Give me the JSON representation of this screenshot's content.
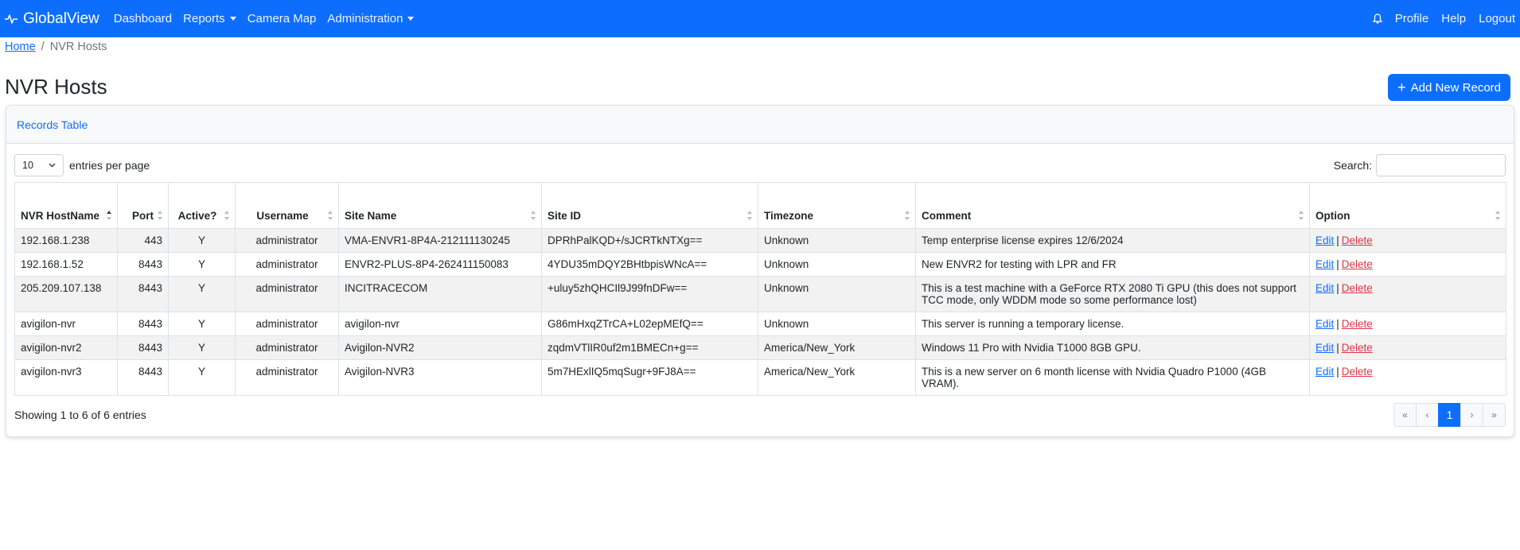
{
  "app": {
    "brand": "GlobalView"
  },
  "nav": {
    "items": [
      {
        "label": "Dashboard",
        "dropdown": false
      },
      {
        "label": "Reports",
        "dropdown": true
      },
      {
        "label": "Camera Map",
        "dropdown": false
      },
      {
        "label": "Administration",
        "dropdown": true
      }
    ],
    "right": {
      "profile": "Profile",
      "help": "Help",
      "logout": "Logout"
    }
  },
  "breadcrumb": {
    "home": "Home",
    "current": "NVR Hosts"
  },
  "page": {
    "title": "NVR Hosts",
    "add_button": "Add New Record"
  },
  "card": {
    "header": "Records Table"
  },
  "controls": {
    "entries_value": "10",
    "entries_label": "entries per page",
    "search_label": "Search:",
    "search_value": ""
  },
  "table": {
    "columns": [
      "NVR HostName",
      "Port",
      "Active?",
      "Username",
      "Site Name",
      "Site ID",
      "Timezone",
      "Comment",
      "Option"
    ],
    "rows": [
      {
        "host": "192.168.1.238",
        "port": "443",
        "active": "Y",
        "username": "administrator",
        "site_name": "VMA-ENVR1-8P4A-212111130245",
        "site_id": "DPRhPalKQD+/sJCRTkNTXg==",
        "timezone": "Unknown",
        "comment": "Temp enterprise license expires 12/6/2024"
      },
      {
        "host": "192.168.1.52",
        "port": "8443",
        "active": "Y",
        "username": "administrator",
        "site_name": "ENVR2-PLUS-8P4-262411150083",
        "site_id": "4YDU35mDQY2BHtbpisWNcA==",
        "timezone": "Unknown",
        "comment": "New ENVR2 for testing with LPR and FR"
      },
      {
        "host": "205.209.107.138",
        "port": "8443",
        "active": "Y",
        "username": "administrator",
        "site_name": "INCITRACECOM",
        "site_id": "+uluy5zhQHCIl9J99fnDFw==",
        "timezone": "Unknown",
        "comment": "This is a test machine with a GeForce RTX 2080 Ti GPU (this does not support TCC mode, only WDDM mode so some performance lost)"
      },
      {
        "host": "avigilon-nvr",
        "port": "8443",
        "active": "Y",
        "username": "administrator",
        "site_name": "avigilon-nvr",
        "site_id": "G86mHxqZTrCA+L02epMEfQ==",
        "timezone": "Unknown",
        "comment": "This server is running a temporary license."
      },
      {
        "host": "avigilon-nvr2",
        "port": "8443",
        "active": "Y",
        "username": "administrator",
        "site_name": "Avigilon-NVR2",
        "site_id": "zqdmVTlIR0uf2m1BMECn+g==",
        "timezone": "America/New_York",
        "comment": "Windows 11 Pro with Nvidia T1000 8GB GPU."
      },
      {
        "host": "avigilon-nvr3",
        "port": "8443",
        "active": "Y",
        "username": "administrator",
        "site_name": "Avigilon-NVR3",
        "site_id": "5m7HExlIQ5mqSugr+9FJ8A==",
        "timezone": "America/New_York",
        "comment": "This is a new server on 6 month license with Nvidia Quadro P1000 (4GB VRAM)."
      }
    ],
    "option_edit": "Edit",
    "option_sep": "|",
    "option_delete": "Delete"
  },
  "footer": {
    "info": "Showing 1 to 6 of 6 entries",
    "pager": {
      "first": "«",
      "prev": "‹",
      "page": "1",
      "next": "›",
      "last": "»"
    }
  },
  "icons": {
    "brand": "pulse-icon",
    "bell": "bell-icon"
  },
  "colors": {
    "primary": "#0d6efd",
    "danger": "#dc3545",
    "stripe": "#f2f2f2"
  }
}
